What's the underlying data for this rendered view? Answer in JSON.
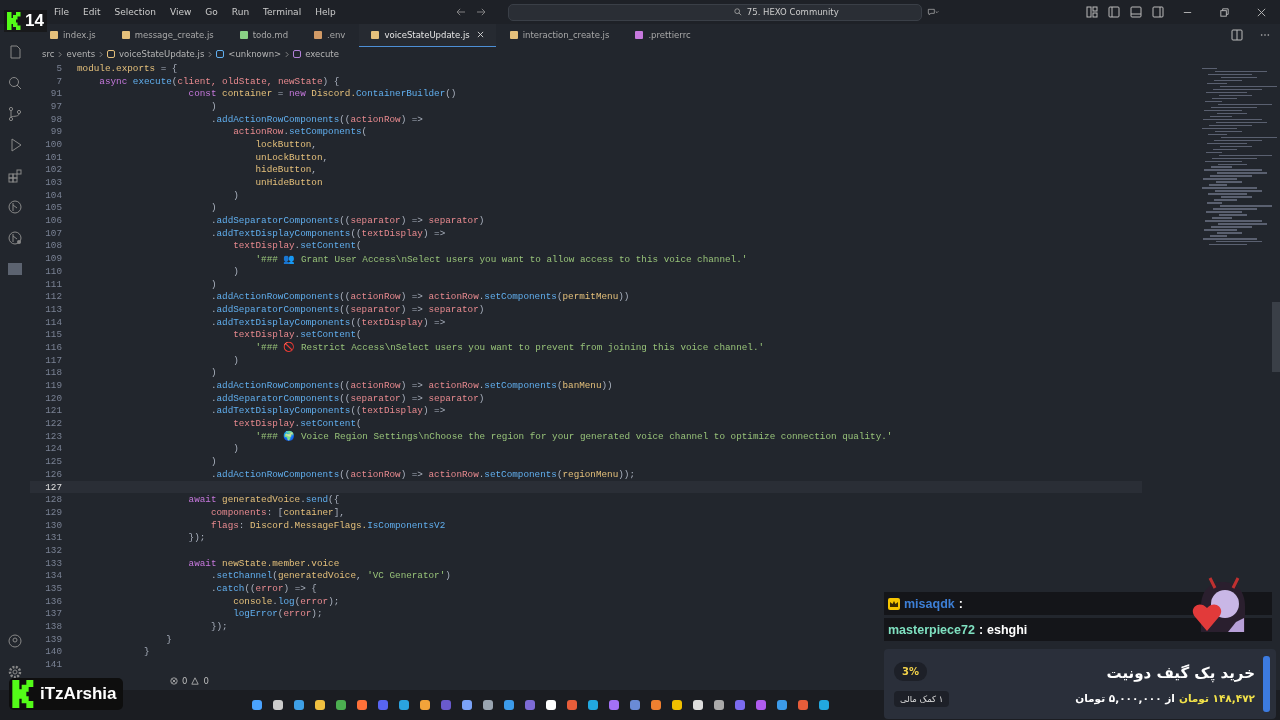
{
  "overlay_badge": {
    "number": "14"
  },
  "menu": [
    "File",
    "Edit",
    "Selection",
    "View",
    "Go",
    "Run",
    "Terminal",
    "Help"
  ],
  "search": {
    "value": "75. HEXO Community"
  },
  "tabs": [
    {
      "label": "index.js",
      "kind": "js",
      "selected": false
    },
    {
      "label": "message_create.js",
      "kind": "js",
      "selected": false
    },
    {
      "label": "todo.md",
      "kind": "md",
      "selected": false
    },
    {
      "label": ".env",
      "kind": "env",
      "selected": false
    },
    {
      "label": "voiceStateUpdate.js",
      "kind": "js",
      "selected": true
    },
    {
      "label": "interaction_create.js",
      "kind": "js",
      "selected": false
    },
    {
      "label": ".prettierrc",
      "kind": "rc",
      "selected": false
    }
  ],
  "breadcrumb": [
    {
      "label": "src",
      "kind": "folder"
    },
    {
      "label": "events",
      "kind": "folder"
    },
    {
      "label": "voiceStateUpdate.js",
      "kind": "js"
    },
    {
      "label": "<unknown>",
      "kind": "object"
    },
    {
      "label": "execute",
      "kind": "method"
    }
  ],
  "code": [
    {
      "num": "5",
      "current": false,
      "tokens": [
        {
          "t": "module",
          "kind": "cls"
        },
        {
          "t": ".exports",
          "kind": "cls"
        },
        {
          "t": " = {",
          "kind": "p"
        }
      ]
    },
    {
      "num": "7",
      "current": false,
      "tokens": [
        {
          "t": "    async ",
          "kind": "kw"
        },
        {
          "t": "execute",
          "kind": "fn"
        },
        {
          "t": "(",
          "kind": "p"
        },
        {
          "t": "client, oldState, newState",
          "kind": "var"
        },
        {
          "t": ") {",
          "kind": "p"
        }
      ]
    },
    {
      "num": "91",
      "current": false,
      "tokens": [
        {
          "t": "                    const ",
          "kind": "kw"
        },
        {
          "t": "container",
          "kind": "cls"
        },
        {
          "t": " = ",
          "kind": "p"
        },
        {
          "t": "new ",
          "kind": "kw"
        },
        {
          "t": "Discord.",
          "kind": "cls"
        },
        {
          "t": "ContainerBuilder",
          "kind": "fn"
        },
        {
          "t": "()",
          "kind": "p"
        }
      ]
    },
    {
      "num": "97",
      "current": false,
      "tokens": [
        {
          "t": "                        )",
          "kind": "p"
        }
      ]
    },
    {
      "num": "98",
      "current": false,
      "tokens": [
        {
          "t": "                        .",
          "kind": "p"
        },
        {
          "t": "addActionRowComponents",
          "kind": "fn"
        },
        {
          "t": "((",
          "kind": "p"
        },
        {
          "t": "actionRow",
          "kind": "var"
        },
        {
          "t": ") =>",
          "kind": "p"
        }
      ]
    },
    {
      "num": "99",
      "current": false,
      "tokens": [
        {
          "t": "                            actionRow",
          "kind": "var"
        },
        {
          "t": ".",
          "kind": "p"
        },
        {
          "t": "setComponents",
          "kind": "fn"
        },
        {
          "t": "(",
          "kind": "p"
        }
      ]
    },
    {
      "num": "100",
      "current": false,
      "tokens": [
        {
          "t": "                                lockButton",
          "kind": "cls"
        },
        {
          "t": ",",
          "kind": "p"
        }
      ]
    },
    {
      "num": "101",
      "current": false,
      "tokens": [
        {
          "t": "                                unLockButton",
          "kind": "cls"
        },
        {
          "t": ",",
          "kind": "p"
        }
      ]
    },
    {
      "num": "102",
      "current": false,
      "tokens": [
        {
          "t": "                                hideButton",
          "kind": "cls"
        },
        {
          "t": ",",
          "kind": "p"
        }
      ]
    },
    {
      "num": "103",
      "current": false,
      "tokens": [
        {
          "t": "                                unHideButton",
          "kind": "cls"
        }
      ]
    },
    {
      "num": "104",
      "current": false,
      "tokens": [
        {
          "t": "                            )",
          "kind": "p"
        }
      ]
    },
    {
      "num": "105",
      "current": false,
      "tokens": [
        {
          "t": "                        )",
          "kind": "p"
        }
      ]
    },
    {
      "num": "106",
      "current": false,
      "tokens": [
        {
          "t": "                        .",
          "kind": "p"
        },
        {
          "t": "addSeparatorComponents",
          "kind": "fn"
        },
        {
          "t": "((",
          "kind": "p"
        },
        {
          "t": "separator",
          "kind": "var"
        },
        {
          "t": ") => ",
          "kind": "p"
        },
        {
          "t": "separator",
          "kind": "var"
        },
        {
          "t": ")",
          "kind": "p"
        }
      ]
    },
    {
      "num": "107",
      "current": false,
      "tokens": [
        {
          "t": "                        .",
          "kind": "p"
        },
        {
          "t": "addTextDisplayComponents",
          "kind": "fn"
        },
        {
          "t": "((",
          "kind": "p"
        },
        {
          "t": "textDisplay",
          "kind": "var"
        },
        {
          "t": ") =>",
          "kind": "p"
        }
      ]
    },
    {
      "num": "108",
      "current": false,
      "tokens": [
        {
          "t": "                            textDisplay",
          "kind": "var"
        },
        {
          "t": ".",
          "kind": "p"
        },
        {
          "t": "setContent",
          "kind": "fn"
        },
        {
          "t": "(",
          "kind": "p"
        }
      ]
    },
    {
      "num": "109",
      "current": false,
      "tokens": [
        {
          "t": "                                '### 👥 Grant User Access\\nSelect users you want to allow access to this voice channel.'",
          "kind": "str"
        }
      ]
    },
    {
      "num": "110",
      "current": false,
      "tokens": [
        {
          "t": "                            )",
          "kind": "p"
        }
      ]
    },
    {
      "num": "111",
      "current": false,
      "tokens": [
        {
          "t": "                        )",
          "kind": "p"
        }
      ]
    },
    {
      "num": "112",
      "current": false,
      "tokens": [
        {
          "t": "                        .",
          "kind": "p"
        },
        {
          "t": "addActionRowComponents",
          "kind": "fn"
        },
        {
          "t": "((",
          "kind": "p"
        },
        {
          "t": "actionRow",
          "kind": "var"
        },
        {
          "t": ") => ",
          "kind": "p"
        },
        {
          "t": "actionRow",
          "kind": "var"
        },
        {
          "t": ".",
          "kind": "p"
        },
        {
          "t": "setComponents",
          "kind": "fn"
        },
        {
          "t": "(",
          "kind": "p"
        },
        {
          "t": "permitMenu",
          "kind": "cls"
        },
        {
          "t": "))",
          "kind": "p"
        }
      ]
    },
    {
      "num": "113",
      "current": false,
      "tokens": [
        {
          "t": "                        .",
          "kind": "p"
        },
        {
          "t": "addSeparatorComponents",
          "kind": "fn"
        },
        {
          "t": "((",
          "kind": "p"
        },
        {
          "t": "separator",
          "kind": "var"
        },
        {
          "t": ") => ",
          "kind": "p"
        },
        {
          "t": "separator",
          "kind": "var"
        },
        {
          "t": ")",
          "kind": "p"
        }
      ]
    },
    {
      "num": "114",
      "current": false,
      "tokens": [
        {
          "t": "                        .",
          "kind": "p"
        },
        {
          "t": "addTextDisplayComponents",
          "kind": "fn"
        },
        {
          "t": "((",
          "kind": "p"
        },
        {
          "t": "textDisplay",
          "kind": "var"
        },
        {
          "t": ") =>",
          "kind": "p"
        }
      ]
    },
    {
      "num": "115",
      "current": false,
      "tokens": [
        {
          "t": "                            textDisplay",
          "kind": "var"
        },
        {
          "t": ".",
          "kind": "p"
        },
        {
          "t": "setContent",
          "kind": "fn"
        },
        {
          "t": "(",
          "kind": "p"
        }
      ]
    },
    {
      "num": "116",
      "current": false,
      "tokens": [
        {
          "t": "                                '### 🚫 Restrict Access\\nSelect users you want to prevent from joining this voice channel.'",
          "kind": "str"
        }
      ]
    },
    {
      "num": "117",
      "current": false,
      "tokens": [
        {
          "t": "                            )",
          "kind": "p"
        }
      ]
    },
    {
      "num": "118",
      "current": false,
      "tokens": [
        {
          "t": "                        )",
          "kind": "p"
        }
      ]
    },
    {
      "num": "119",
      "current": false,
      "tokens": [
        {
          "t": "                        .",
          "kind": "p"
        },
        {
          "t": "addActionRowComponents",
          "kind": "fn"
        },
        {
          "t": "((",
          "kind": "p"
        },
        {
          "t": "actionRow",
          "kind": "var"
        },
        {
          "t": ") => ",
          "kind": "p"
        },
        {
          "t": "actionRow",
          "kind": "var"
        },
        {
          "t": ".",
          "kind": "p"
        },
        {
          "t": "setComponents",
          "kind": "fn"
        },
        {
          "t": "(",
          "kind": "p"
        },
        {
          "t": "banMenu",
          "kind": "cls"
        },
        {
          "t": "))",
          "kind": "p"
        }
      ]
    },
    {
      "num": "120",
      "current": false,
      "tokens": [
        {
          "t": "                        .",
          "kind": "p"
        },
        {
          "t": "addSeparatorComponents",
          "kind": "fn"
        },
        {
          "t": "((",
          "kind": "p"
        },
        {
          "t": "separator",
          "kind": "var"
        },
        {
          "t": ") => ",
          "kind": "p"
        },
        {
          "t": "separator",
          "kind": "var"
        },
        {
          "t": ")",
          "kind": "p"
        }
      ]
    },
    {
      "num": "121",
      "current": false,
      "tokens": [
        {
          "t": "                        .",
          "kind": "p"
        },
        {
          "t": "addTextDisplayComponents",
          "kind": "fn"
        },
        {
          "t": "((",
          "kind": "p"
        },
        {
          "t": "textDisplay",
          "kind": "var"
        },
        {
          "t": ") =>",
          "kind": "p"
        }
      ]
    },
    {
      "num": "122",
      "current": false,
      "tokens": [
        {
          "t": "                            textDisplay",
          "kind": "var"
        },
        {
          "t": ".",
          "kind": "p"
        },
        {
          "t": "setContent",
          "kind": "fn"
        },
        {
          "t": "(",
          "kind": "p"
        }
      ]
    },
    {
      "num": "123",
      "current": false,
      "tokens": [
        {
          "t": "                                '### 🌍 Voice Region Settings\\nChoose the region for your generated voice channel to optimize connection quality.'",
          "kind": "str"
        }
      ]
    },
    {
      "num": "124",
      "current": false,
      "tokens": [
        {
          "t": "                            )",
          "kind": "p"
        }
      ]
    },
    {
      "num": "125",
      "current": false,
      "tokens": [
        {
          "t": "                        )",
          "kind": "p"
        }
      ]
    },
    {
      "num": "126",
      "current": false,
      "tokens": [
        {
          "t": "                        .",
          "kind": "p"
        },
        {
          "t": "addActionRowComponents",
          "kind": "fn"
        },
        {
          "t": "((",
          "kind": "p"
        },
        {
          "t": "actionRow",
          "kind": "var"
        },
        {
          "t": ") => ",
          "kind": "p"
        },
        {
          "t": "actionRow",
          "kind": "var"
        },
        {
          "t": ".",
          "kind": "p"
        },
        {
          "t": "setComponents",
          "kind": "fn"
        },
        {
          "t": "(",
          "kind": "p"
        },
        {
          "t": "regionMenu",
          "kind": "cls"
        },
        {
          "t": "));",
          "kind": "p"
        }
      ]
    },
    {
      "num": "127",
      "current": true
    },
    {
      "num": "128",
      "current": false,
      "tokens": [
        {
          "t": "                    await ",
          "kind": "kw"
        },
        {
          "t": "generatedVoice",
          "kind": "cls"
        },
        {
          "t": ".",
          "kind": "p"
        },
        {
          "t": "send",
          "kind": "fn"
        },
        {
          "t": "({",
          "kind": "p"
        }
      ]
    },
    {
      "num": "129",
      "current": false,
      "tokens": [
        {
          "t": "                        components",
          "kind": "var"
        },
        {
          "t": ": [",
          "kind": "p"
        },
        {
          "t": "container",
          "kind": "cls"
        },
        {
          "t": "],",
          "kind": "p"
        }
      ]
    },
    {
      "num": "130",
      "current": false,
      "tokens": [
        {
          "t": "                        flags",
          "kind": "var"
        },
        {
          "t": ": ",
          "kind": "p"
        },
        {
          "t": "Discord.MessageFlags.",
          "kind": "cls"
        },
        {
          "t": "IsComponentsV2",
          "kind": "fn"
        }
      ]
    },
    {
      "num": "131",
      "current": false,
      "tokens": [
        {
          "t": "                    });",
          "kind": "p"
        }
      ]
    },
    {
      "num": "132",
      "current": false
    },
    {
      "num": "133",
      "current": false,
      "tokens": [
        {
          "t": "                    await ",
          "kind": "kw"
        },
        {
          "t": "newState.member.voice",
          "kind": "cls"
        }
      ]
    },
    {
      "num": "134",
      "current": false,
      "tokens": [
        {
          "t": "                        .",
          "kind": "p"
        },
        {
          "t": "setChannel",
          "kind": "fn"
        },
        {
          "t": "(",
          "kind": "p"
        },
        {
          "t": "generatedVoice",
          "kind": "cls"
        },
        {
          "t": ", ",
          "kind": "p"
        },
        {
          "t": "'VC Generator'",
          "kind": "str"
        },
        {
          "t": ")",
          "kind": "p"
        }
      ]
    },
    {
      "num": "135",
      "current": false,
      "tokens": [
        {
          "t": "                        .",
          "kind": "p"
        },
        {
          "t": "catch",
          "kind": "fn"
        },
        {
          "t": "((",
          "kind": "p"
        },
        {
          "t": "error",
          "kind": "var"
        },
        {
          "t": ") => {",
          "kind": "p"
        }
      ]
    },
    {
      "num": "136",
      "current": false,
      "tokens": [
        {
          "t": "                            console",
          "kind": "cls"
        },
        {
          "t": ".",
          "kind": "p"
        },
        {
          "t": "log",
          "kind": "fn"
        },
        {
          "t": "(",
          "kind": "p"
        },
        {
          "t": "error",
          "kind": "var"
        },
        {
          "t": ");",
          "kind": "p"
        }
      ]
    },
    {
      "num": "137",
      "current": false,
      "tokens": [
        {
          "t": "                            logError",
          "kind": "fn"
        },
        {
          "t": "(",
          "kind": "p"
        },
        {
          "t": "error",
          "kind": "var"
        },
        {
          "t": ");",
          "kind": "p"
        }
      ]
    },
    {
      "num": "138",
      "current": false,
      "tokens": [
        {
          "t": "                        });",
          "kind": "p"
        }
      ]
    },
    {
      "num": "139",
      "current": false,
      "tokens": [
        {
          "t": "                }",
          "kind": "p"
        }
      ]
    },
    {
      "num": "140",
      "current": false,
      "tokens": [
        {
          "t": "            }",
          "kind": "p"
        }
      ]
    },
    {
      "num": "141",
      "current": false
    }
  ],
  "status_bar": {
    "errors": "0",
    "warnings": "0"
  },
  "streamer_badge": {
    "name": "iTzArshia"
  },
  "chat": [
    {
      "user": "misaqdk",
      "separator": ":",
      "color": "#3d7fd6",
      "crown": true
    },
    {
      "user": "masterpiece72",
      "separator": ":",
      "message": "eshghi",
      "color": "#7fe0c0",
      "crown": false
    }
  ],
  "donation": {
    "title": "خرید پک گیف دونیت",
    "raised": "۱۴۸,۴۷۲ تومان",
    "goal": "از ۵,۰۰۰,۰۰۰ تومان",
    "percent": "3%",
    "supporters": "۱ کمک مالی"
  }
}
